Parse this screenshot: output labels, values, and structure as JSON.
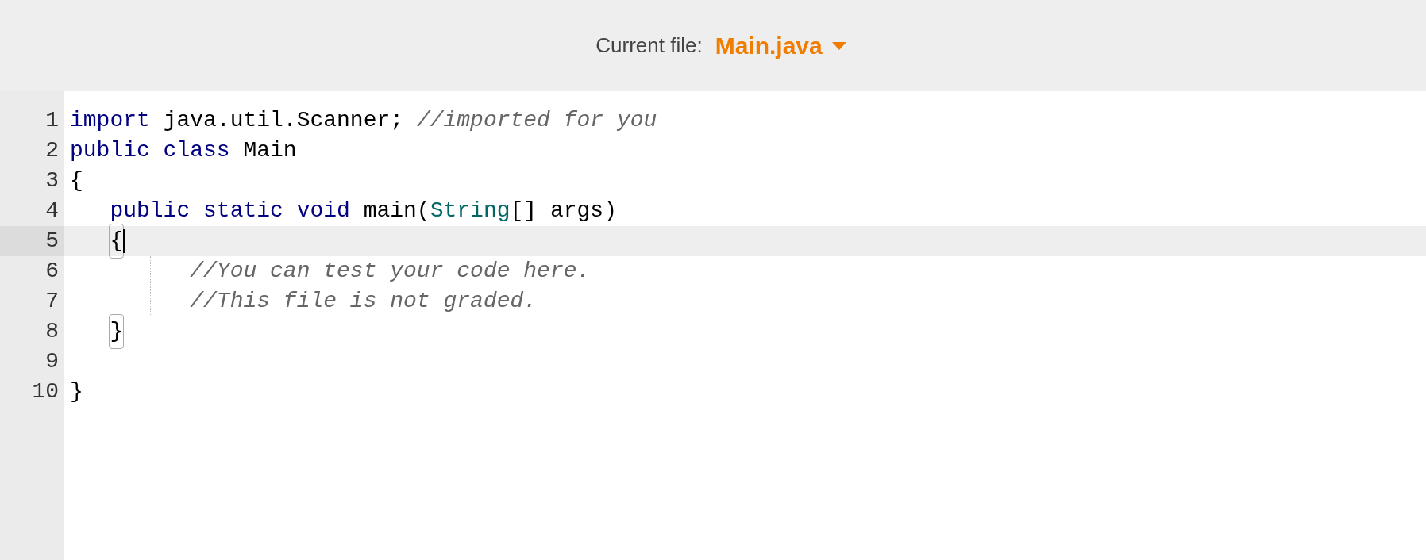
{
  "header": {
    "label": "Current file:",
    "file": "Main.java"
  },
  "editor": {
    "lines": [
      {
        "number": "1",
        "active": false,
        "cursor": false,
        "tokens": [
          {
            "kind": "keyword",
            "text": "import"
          },
          {
            "kind": "plain",
            "text": " java.util.Scanner; "
          },
          {
            "kind": "comment",
            "text": "//imported for you"
          }
        ]
      },
      {
        "number": "2",
        "active": false,
        "cursor": false,
        "tokens": [
          {
            "kind": "keyword",
            "text": "public class"
          },
          {
            "kind": "plain",
            "text": " Main"
          }
        ]
      },
      {
        "number": "3",
        "active": false,
        "cursor": false,
        "tokens": [
          {
            "kind": "plain",
            "text": "{"
          }
        ]
      },
      {
        "number": "4",
        "active": false,
        "cursor": false,
        "tokens": [
          {
            "kind": "indent"
          },
          {
            "kind": "keyword",
            "text": "public static void"
          },
          {
            "kind": "plain",
            "text": " main("
          },
          {
            "kind": "type",
            "text": "String"
          },
          {
            "kind": "plain",
            "text": "[] args)"
          }
        ]
      },
      {
        "number": "5",
        "active": true,
        "cursor": true,
        "tokens": [
          {
            "kind": "indent"
          },
          {
            "kind": "match",
            "text": "{"
          }
        ]
      },
      {
        "number": "6",
        "active": false,
        "cursor": false,
        "tokens": [
          {
            "kind": "indent"
          },
          {
            "kind": "guide"
          },
          {
            "kind": "guide"
          },
          {
            "kind": "comment",
            "text": "//You can test your code here."
          }
        ]
      },
      {
        "number": "7",
        "active": false,
        "cursor": false,
        "tokens": [
          {
            "kind": "indent"
          },
          {
            "kind": "guide"
          },
          {
            "kind": "guide"
          },
          {
            "kind": "comment",
            "text": "//This file is not graded."
          }
        ]
      },
      {
        "number": "8",
        "active": false,
        "cursor": false,
        "tokens": [
          {
            "kind": "indent"
          },
          {
            "kind": "match",
            "text": "}"
          }
        ]
      },
      {
        "number": "9",
        "active": false,
        "cursor": false
      },
      {
        "number": "10",
        "active": false,
        "cursor": false,
        "tokens": [
          {
            "kind": "plain",
            "text": "}"
          }
        ]
      }
    ]
  }
}
